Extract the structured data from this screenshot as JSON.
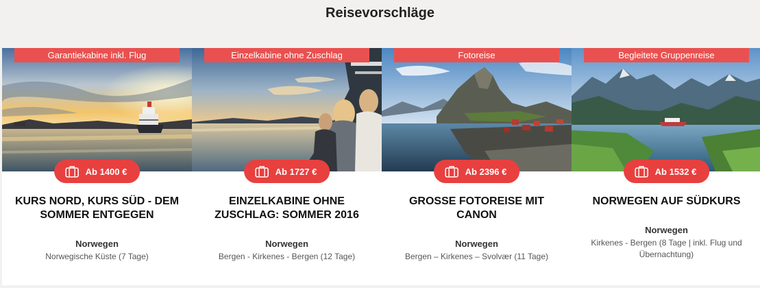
{
  "page": {
    "title": "Reisevorschläge"
  },
  "cards": [
    {
      "ribbon": "Garantiekabine inkl. Flug",
      "price": "Ab 1400 €",
      "title": "KURS NORD, KURS SÜD - DEM SOMMER ENTGEGEN",
      "region": "Norwegen",
      "route": "Norwegische Küste (7 Tage)"
    },
    {
      "ribbon": "Einzelkabine ohne Zuschlag",
      "price": "Ab 1727 €",
      "title": "EINZELKABINE OHNE ZUSCHLAG: SOMMER 2016",
      "region": "Norwegen",
      "route": "Bergen - Kirkenes - Bergen (12 Tage)"
    },
    {
      "ribbon": "Fotoreise",
      "price": "Ab 2396 €",
      "title": "GROSSE FOTOREISE MIT CANON",
      "region": "Norwegen",
      "route": "Bergen – Kirkenes – Svolvær (11 Tage)"
    },
    {
      "ribbon": "Begleitete Gruppenreise",
      "price": "Ab 1532 €",
      "title": "NORWEGEN AUF SÜDKURS",
      "region": "Norwegen",
      "route": "Kirkenes - Bergen (8 Tage | inkl. Flug und Übernachtung)"
    }
  ],
  "icons": {
    "price_button": "suitcase-icon"
  },
  "colors": {
    "accent": "#e8403f",
    "ribbon": "#e95150",
    "background": "#f3f1ef"
  }
}
